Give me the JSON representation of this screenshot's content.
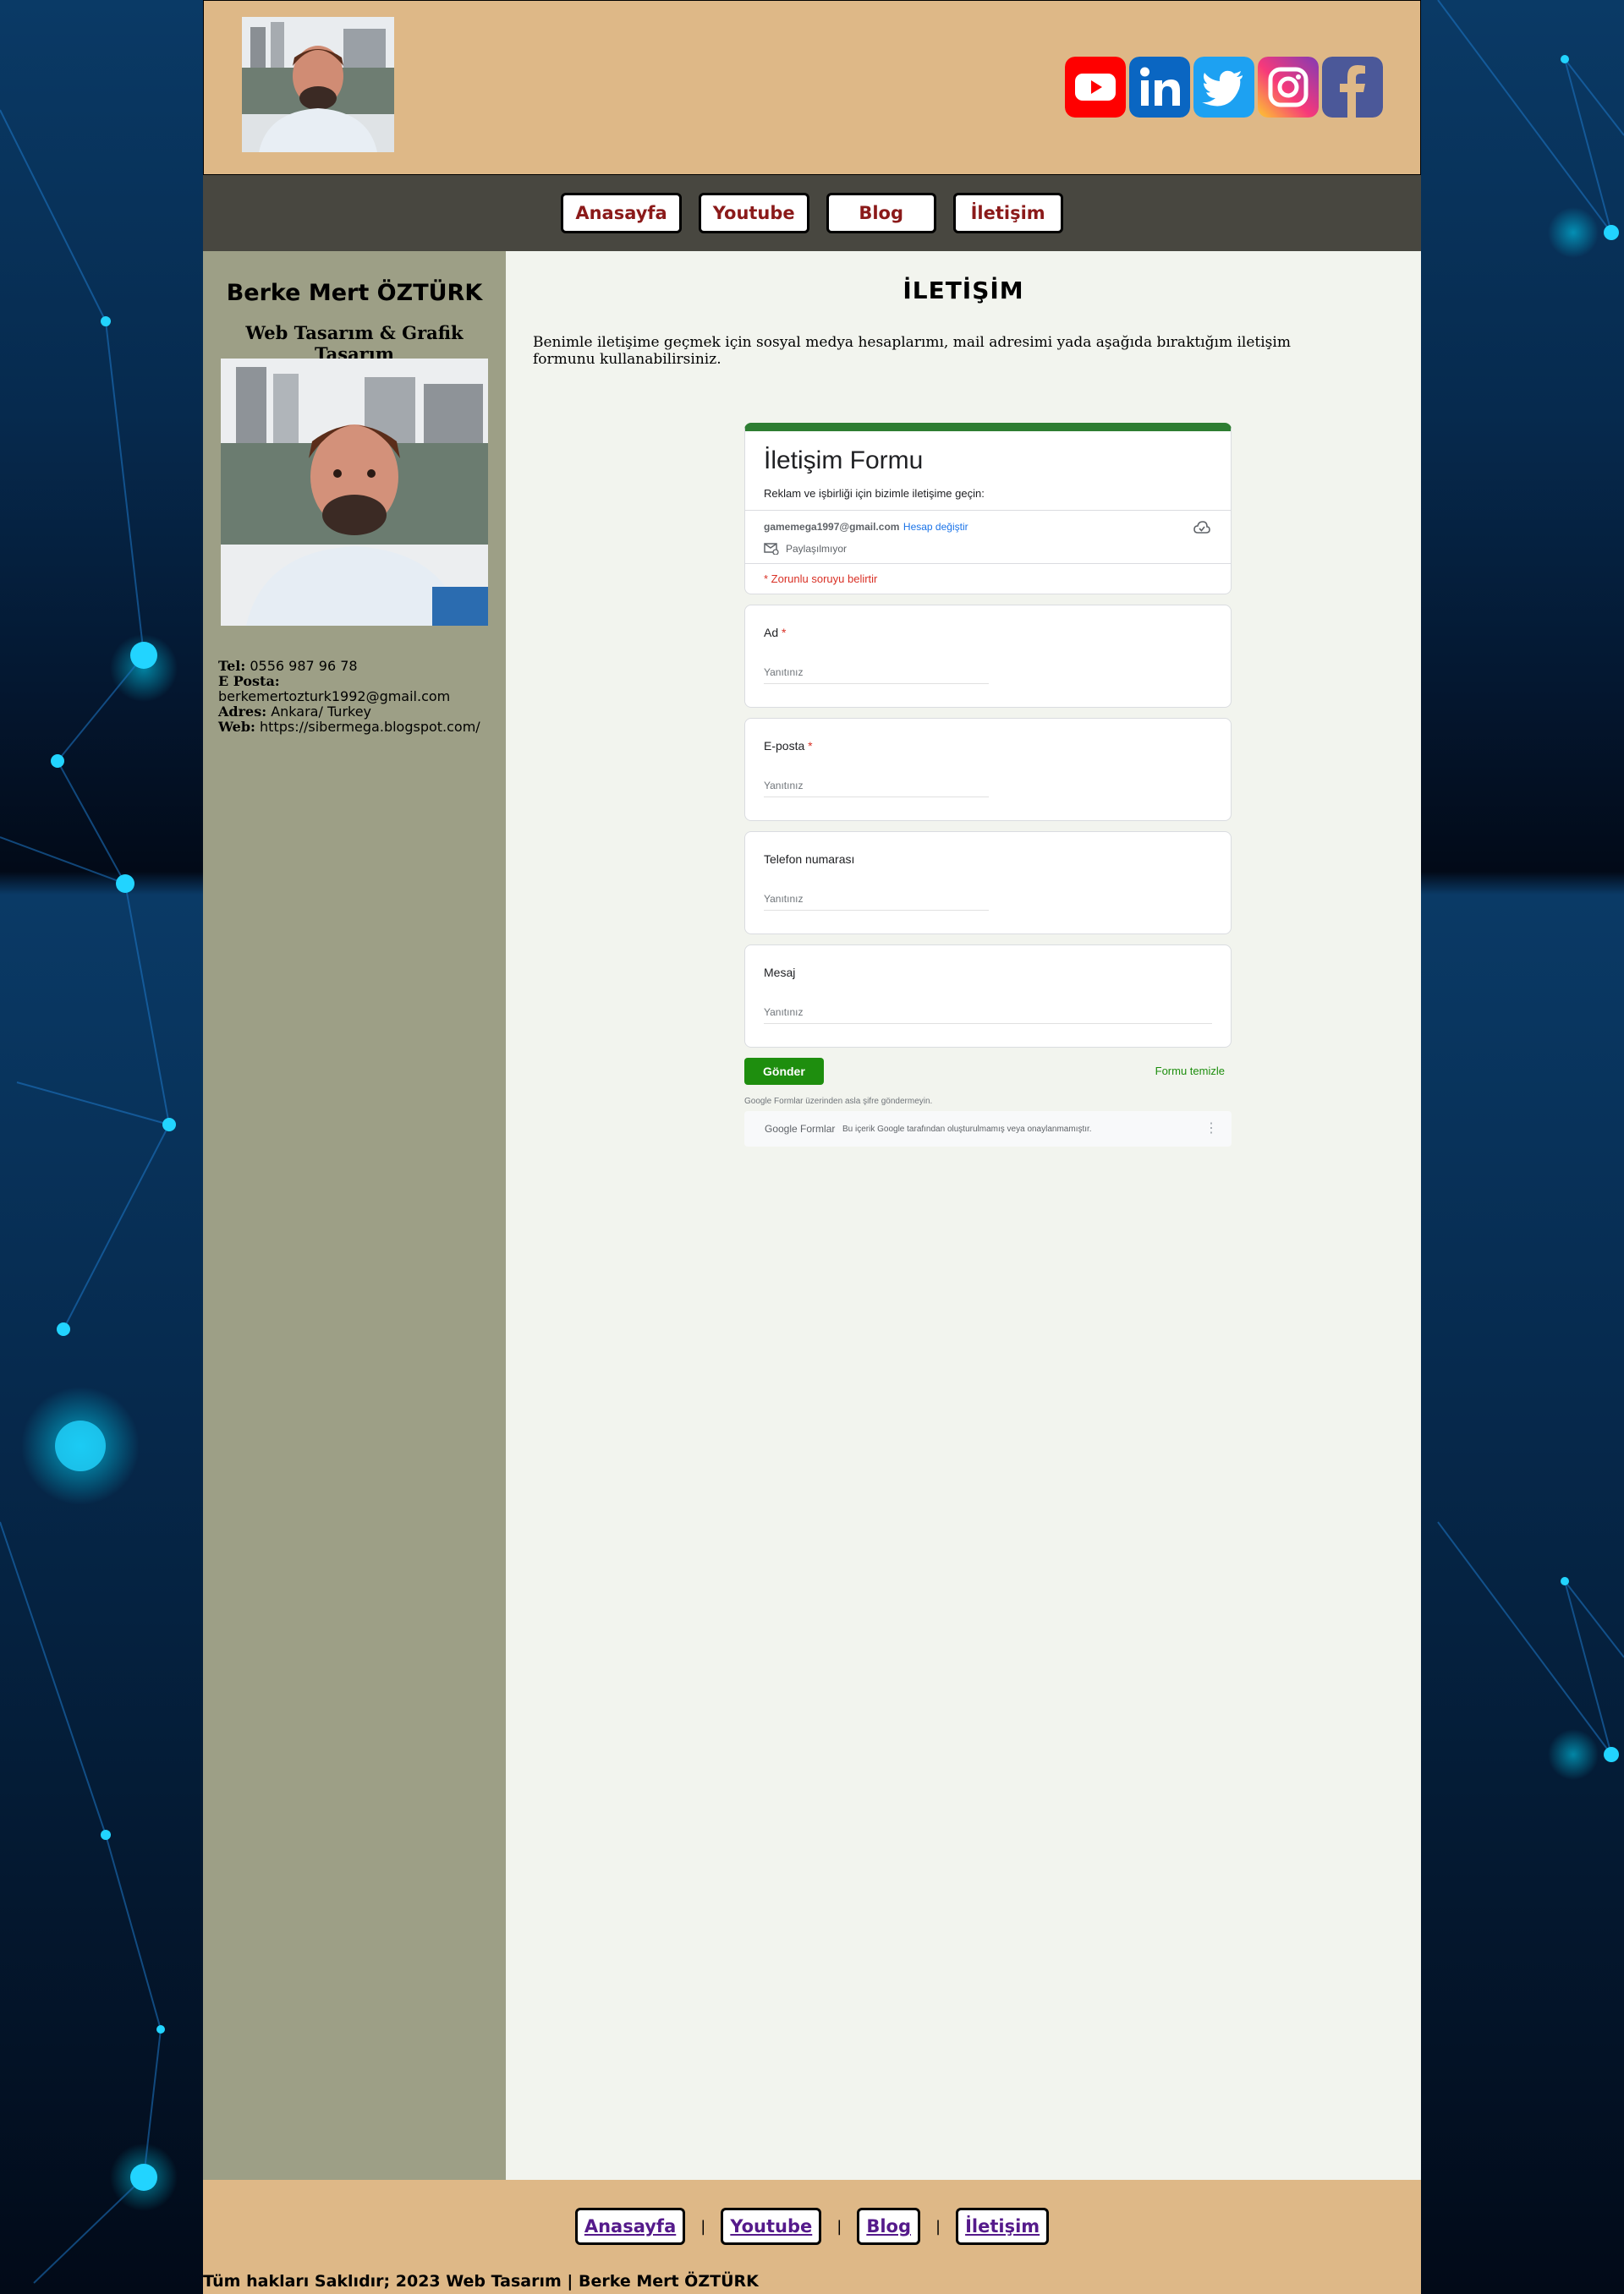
{
  "nav": [
    "Anasayfa",
    "Youtube",
    "Blog",
    "İletişim"
  ],
  "social": [
    {
      "icon": "youtube-icon",
      "color": "#ff0000"
    },
    {
      "icon": "linkedin-icon",
      "color": "#0a66c2"
    },
    {
      "icon": "twitter-icon",
      "color": "#1da1f2"
    },
    {
      "icon": "instagram-icon",
      "color": "#e1306c"
    },
    {
      "icon": "facebook-icon",
      "color": "#4b5899"
    }
  ],
  "sidebar": {
    "name": "Berke Mert ÖZTÜRK",
    "subtitle": "Web Tasarım & Grafik Tasarım",
    "tel_label": "Tel:",
    "tel": "0556 987 96 78",
    "email_label": "E Posta:",
    "email": "berkemertozturk1992@gmail.com",
    "address_label": "Adres:",
    "address": "Ankara/ Turkey",
    "web_label": "Web:",
    "web": "https://sibermega.blogspot.com/"
  },
  "main": {
    "title": "İLETİŞİM",
    "text": "Benimle iletişime geçmek için sosyal medya hesaplarımı, mail adresimi yada aşağıda bıraktığım iletişim formunu kullanabilirsiniz."
  },
  "form": {
    "title": "İletişim Formu",
    "description": "Reklam ve işbirliği için bizimle iletişime geçin:",
    "account_email": "gamemega1997@gmail.com",
    "switch_account": "Hesap değiştir",
    "not_shared": "Paylaşılmıyor",
    "required_note": "* Zorunlu soruyu belirtir",
    "required_star": "*",
    "questions": [
      {
        "label": "Ad",
        "placeholder": "Yanıtınız"
      },
      {
        "label": "E-posta",
        "placeholder": "Yanıtınız"
      },
      {
        "label": "Telefon numarası",
        "placeholder": "Yanıtınız"
      },
      {
        "label": "Mesaj",
        "placeholder": "Yanıtınız"
      }
    ],
    "submit": "Gönder",
    "clear": "Formu temizle",
    "never_password": "Google Formlar üzerinden asla şifre göndermeyin.",
    "brand": "Google Formlar",
    "disclaimer": "Bu içerik Google tarafından oluşturulmamış veya onaylanmamıştır.",
    "more": "⋮"
  },
  "footer": {
    "separator": "|",
    "copyright": "Tüm hakları Saklıdır; 2023 Web Tasarım | Berke Mert ÖZTÜRK"
  }
}
